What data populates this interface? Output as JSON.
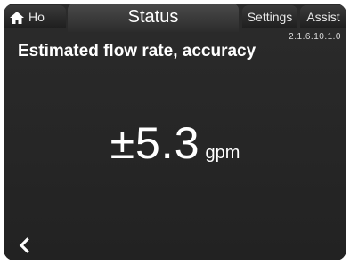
{
  "tabs": {
    "home_label": "Ho",
    "status_label": "Status",
    "settings_label": "Settings",
    "assist_label": "Assist"
  },
  "version": "2.1.6.10.1.0",
  "page_title": "Estimated flow rate, accuracy",
  "reading": {
    "value": "±5.3",
    "unit": "gpm"
  },
  "icons": {
    "home": "home-icon",
    "back": "chevron-left-icon"
  },
  "colors": {
    "background": "#262626",
    "text": "#ffffff"
  }
}
